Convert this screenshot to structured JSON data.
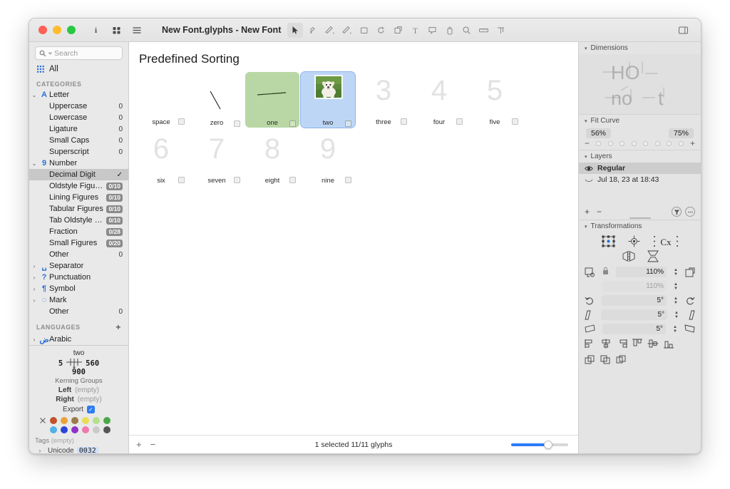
{
  "window": {
    "title": "New Font.glyphs - New Font",
    "traffic_lights": [
      "close",
      "minimize",
      "zoom"
    ],
    "left_icons": [
      "info-icon",
      "grid-view-icon",
      "list-view-icon"
    ],
    "right_icon": "panel-toggle-icon"
  },
  "toolbar": {
    "tools": [
      {
        "name": "select-tool",
        "glyph": "➤",
        "active": true
      },
      {
        "name": "pen-tool",
        "glyph": "✒",
        "active": false
      },
      {
        "name": "draw-tool",
        "glyph": "✎",
        "active": false
      },
      {
        "name": "pencil-tool",
        "glyph": "✏",
        "active": false
      },
      {
        "name": "rectangle-tool",
        "glyph": "□",
        "active": false
      },
      {
        "name": "rotate-tool",
        "glyph": "↺",
        "active": false
      },
      {
        "name": "scale-tool",
        "glyph": "⧉",
        "active": false
      },
      {
        "name": "text-tool",
        "glyph": "T",
        "active": false
      },
      {
        "name": "annotation-tool",
        "glyph": "⬚",
        "active": false
      },
      {
        "name": "hand-tool",
        "glyph": "✋",
        "active": false
      },
      {
        "name": "zoom-tool",
        "glyph": "⚲",
        "active": false
      },
      {
        "name": "measure-tool",
        "glyph": "▄",
        "active": false
      },
      {
        "name": "text-preview-tool",
        "glyph": "Ŧ",
        "active": false
      }
    ]
  },
  "sidebar": {
    "search": {
      "placeholder": "Search",
      "value": ""
    },
    "all_label": "All",
    "categories_header": "CATEGORIES",
    "categories": [
      {
        "label": "Letter",
        "glyph": "A",
        "twisty": "⌄",
        "type": "group"
      },
      {
        "label": "Uppercase",
        "count": "0",
        "type": "child"
      },
      {
        "label": "Lowercase",
        "count": "0",
        "type": "child"
      },
      {
        "label": "Ligature",
        "count": "0",
        "type": "child"
      },
      {
        "label": "Small Caps",
        "count": "0",
        "type": "child"
      },
      {
        "label": "Superscript",
        "count": "0",
        "type": "child"
      },
      {
        "label": "Number",
        "glyph": "9",
        "twisty": "⌄",
        "type": "group"
      },
      {
        "label": "Decimal Digit",
        "check": "✓",
        "type": "child",
        "selected": true
      },
      {
        "label": "Oldstyle Figures",
        "badge": "0/10",
        "type": "child"
      },
      {
        "label": "Lining Figures",
        "badge": "0/10",
        "type": "child"
      },
      {
        "label": "Tabular Figures",
        "badge": "0/10",
        "type": "child"
      },
      {
        "label": "Tab Oldstyle Fi...",
        "badge": "0/10",
        "type": "child"
      },
      {
        "label": "Fraction",
        "badge": "0/28",
        "type": "child"
      },
      {
        "label": "Small Figures",
        "badge": "0/20",
        "type": "child"
      },
      {
        "label": "Other",
        "count": "0",
        "type": "child"
      },
      {
        "label": "Separator",
        "glyph": "␣",
        "twisty": "›",
        "type": "group"
      },
      {
        "label": "Punctuation",
        "glyph": "?",
        "twisty": "›",
        "type": "group"
      },
      {
        "label": "Symbol",
        "glyph": "¶",
        "twisty": "›",
        "type": "group"
      },
      {
        "label": "Mark",
        "glyph": "◌",
        "twisty": "›",
        "type": "group"
      },
      {
        "label": "Other",
        "count": "0",
        "type": "child"
      }
    ],
    "languages_header": "LANGUAGES",
    "languages_add": "+",
    "languages": [
      {
        "label": "Arabic",
        "glyph": "ض",
        "twisty": "›"
      }
    ],
    "glyph_info": {
      "name": "two",
      "left_sidebearing": "5",
      "right_sidebearing": "560",
      "width": "900",
      "kerning_groups_label": "Kerning Groups",
      "left_label": "Left",
      "left_value": "(empty)",
      "right_label": "Right",
      "right_value": "(empty)",
      "export_label": "Export",
      "export_checked": true,
      "colors_row1": [
        "#c0522c",
        "#e9a23b",
        "#9c7b4a",
        "#e8dd55",
        "#b6e08a",
        "#4aa84a"
      ],
      "colors_row2": [
        "#4fb2e8",
        "#2b45d8",
        "#8f33c7",
        "#ef79ae",
        "#c9c9c9",
        "#555555"
      ],
      "tags_label": "Tags",
      "tags_value": "(empty)",
      "unicode_label": "Unicode",
      "unicode_value": "0032"
    },
    "footer_buttons": [
      "remove-button",
      "options-button"
    ]
  },
  "main": {
    "title": "Predefined Sorting",
    "glyphs": [
      {
        "name": "space",
        "display": "",
        "state": "empty"
      },
      {
        "name": "zero",
        "display": "",
        "state": "drawn-slash"
      },
      {
        "name": "one",
        "display": "",
        "state": "green"
      },
      {
        "name": "two",
        "display": "",
        "state": "selected-image"
      },
      {
        "name": "three",
        "display": "3",
        "state": "placeholder"
      },
      {
        "name": "four",
        "display": "4",
        "state": "placeholder"
      },
      {
        "name": "five",
        "display": "5",
        "state": "placeholder"
      },
      {
        "name": "six",
        "display": "6",
        "state": "placeholder"
      },
      {
        "name": "seven",
        "display": "7",
        "state": "placeholder"
      },
      {
        "name": "eight",
        "display": "8",
        "state": "placeholder"
      },
      {
        "name": "nine",
        "display": "9",
        "state": "placeholder"
      }
    ],
    "status_text": "1 selected 11/11 glyphs",
    "zoom_add": "+",
    "zoom_remove": "−"
  },
  "inspector": {
    "dimensions": {
      "header": "Dimensions",
      "preview_top": "HO",
      "preview_bottom": "no t"
    },
    "fit_curve": {
      "header": "Fit Curve",
      "left_value": "56%",
      "right_value": "75%",
      "dots": 8,
      "minus": "−",
      "plus": "+"
    },
    "layers": {
      "header": "Layers",
      "items": [
        {
          "label": "Regular",
          "icon": "eye-icon",
          "selected": true
        },
        {
          "label": "Jul 18, 23 at 18:43",
          "icon": "backup-icon",
          "selected": false
        }
      ],
      "add": "+",
      "remove": "−"
    },
    "transformations": {
      "header": "Transformations",
      "scale_value": "110%",
      "scale_value_secondary": "110%",
      "rotate_value": "5°",
      "slant_value": "5°",
      "skew_value": "5°"
    }
  }
}
